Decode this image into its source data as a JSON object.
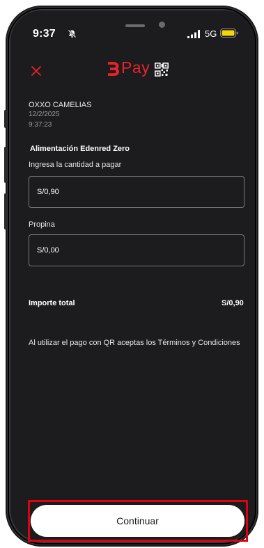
{
  "status_bar": {
    "time": "9:37",
    "network": "5G",
    "icons": [
      "bell-slash-icon",
      "signal-icon",
      "battery-icon"
    ],
    "battery_color": "#f5d800"
  },
  "header": {
    "close_icon": "close-icon",
    "logo_text": "Pay",
    "brand_color": "#e8232b",
    "qr_icon": "qr-code-icon"
  },
  "merchant": {
    "name": "OXXO CAMELIAS",
    "date": "12/2/2025",
    "time": "9:37:23"
  },
  "card": {
    "name": "Alimentación Edenred Zero"
  },
  "amount": {
    "label": "Ingresa la cantidad a pagar",
    "value": "S/0,90"
  },
  "tip": {
    "label": "Propina",
    "value": "S/0,00"
  },
  "total": {
    "label": "Importe total",
    "value": "S/0,90"
  },
  "terms": {
    "text": "Al utilizar el pago con QR aceptas los Términos y Condiciones"
  },
  "actions": {
    "continue_label": "Continuar",
    "highlight_color": "#e0000f"
  }
}
